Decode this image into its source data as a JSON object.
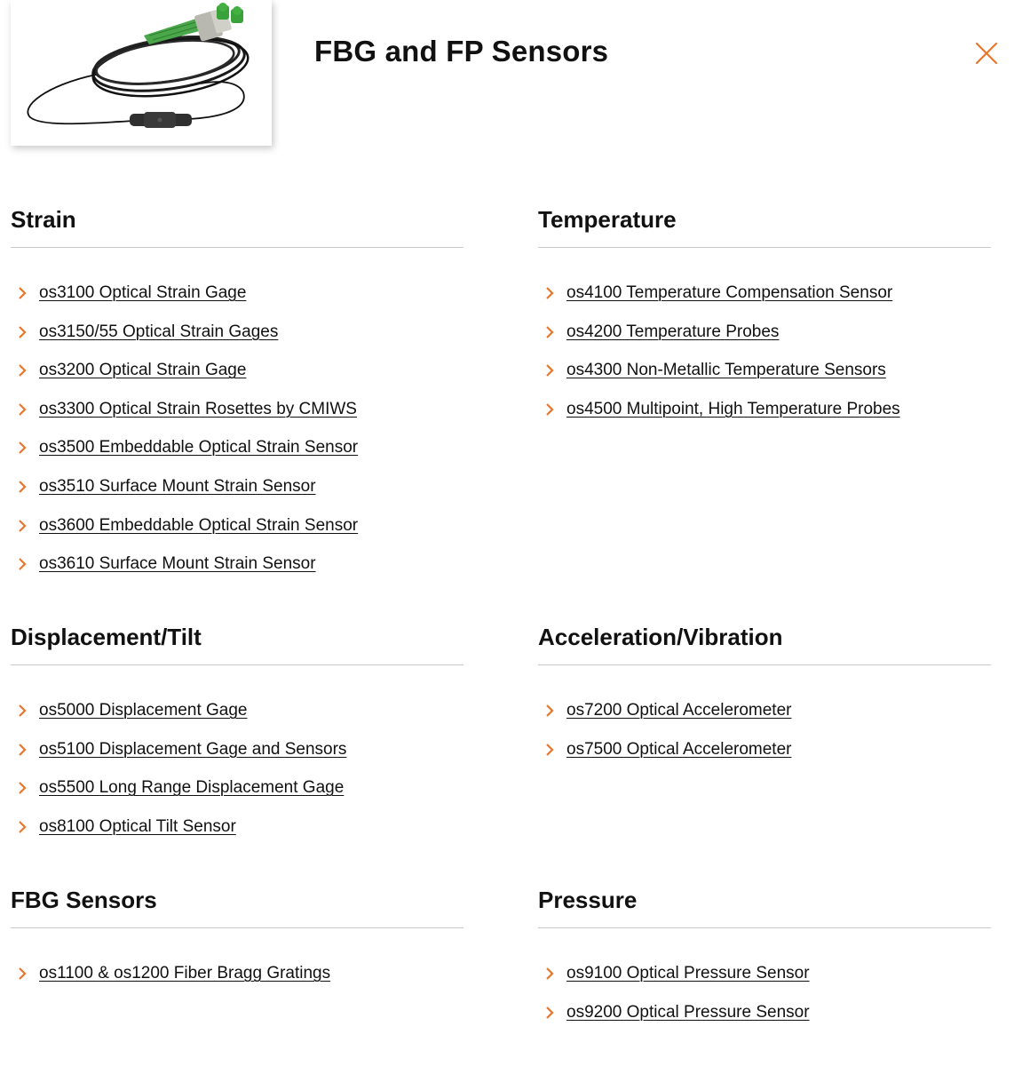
{
  "header": {
    "title": "FBG and FP Sensors",
    "image_icon": "fiber-optic-sensor-cable-image",
    "close_icon": "close-icon",
    "accent_color": "#e8772e"
  },
  "sections": [
    {
      "title": "Strain",
      "links": [
        "os3100 Optical Strain Gage",
        "os3150/55 Optical Strain Gages",
        "os3200 Optical Strain Gage",
        "os3300 Optical Strain Rosettes by CMIWS",
        "os3500 Embeddable Optical Strain Sensor",
        "os3510 Surface Mount Strain Sensor",
        "os3600 Embeddable Optical Strain Sensor",
        "os3610 Surface Mount Strain Sensor"
      ]
    },
    {
      "title": "Temperature",
      "links": [
        "os4100 Temperature Compensation Sensor",
        "os4200 Temperature Probes",
        "os4300 Non-Metallic Temperature Sensors",
        "os4500 Multipoint, High Temperature Probes"
      ]
    },
    {
      "title": "Displacement/Tilt",
      "links": [
        "os5000 Displacement Gage",
        "os5100 Displacement Gage and Sensors",
        "os5500 Long Range Displacement Gage",
        "os8100 Optical Tilt Sensor"
      ]
    },
    {
      "title": "Acceleration/Vibration",
      "links": [
        "os7200 Optical Accelerometer",
        "os7500 Optical Accelerometer"
      ]
    },
    {
      "title": "FBG Sensors",
      "links": [
        "os1100 & os1200 Fiber Bragg Gratings"
      ]
    },
    {
      "title": "Pressure",
      "links": [
        "os9100 Optical Pressure Sensor",
        "os9200 Optical Pressure Sensor"
      ]
    }
  ]
}
